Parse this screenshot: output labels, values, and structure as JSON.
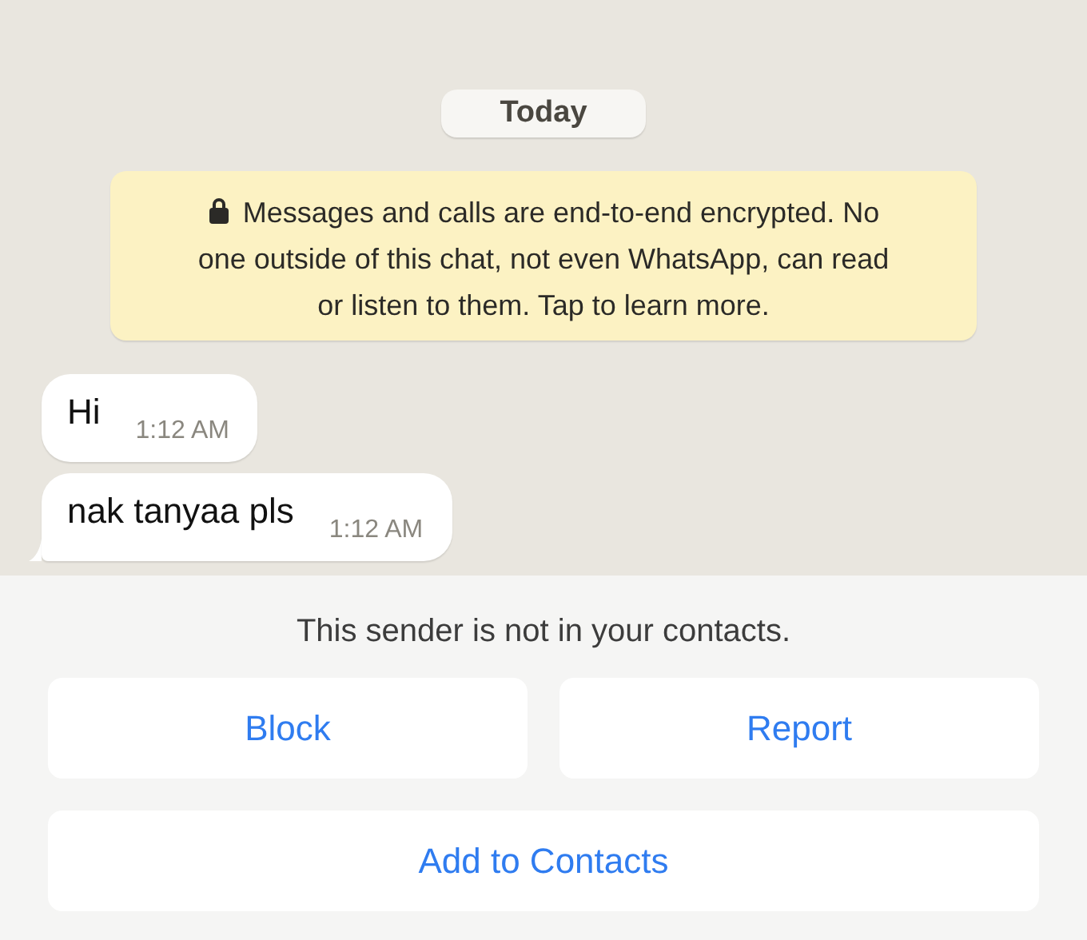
{
  "date_label": "Today",
  "encryption_notice": "Messages and calls are end-to-end encrypted. No one outside of this chat, not even WhatsApp, can read or listen to them. Tap to learn more.",
  "messages": [
    {
      "text": "Hi",
      "time": "1:12 AM",
      "tail": false
    },
    {
      "text": "nak tanyaa pls",
      "time": "1:12 AM",
      "tail": true
    }
  ],
  "unknown_sender": {
    "notice": "This sender is not in your contacts.",
    "buttons": [
      "Block",
      "Report",
      "Add to Contacts"
    ]
  }
}
